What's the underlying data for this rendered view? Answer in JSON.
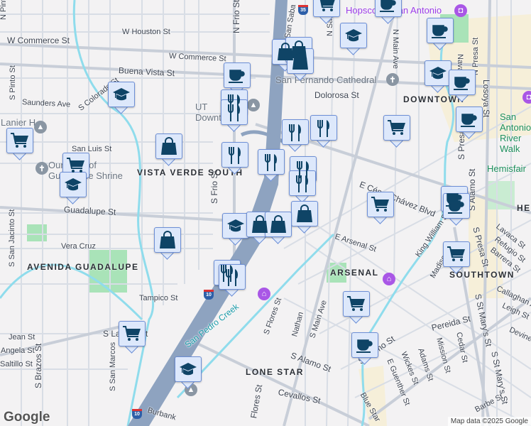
{
  "map": {
    "labels": [
      "W Houston St",
      "W Commerce St",
      "W Commerce St",
      "Buena Vista St",
      "Saunders Ave",
      "S Colorado St",
      "San Luis St",
      "Guadalupe St",
      "N Pinto St",
      "S Pinto St",
      "N Frio St",
      "S Frio St",
      "Vera Cruz",
      "Tampico St",
      "S San Jacinto St",
      "Jean St",
      "Angela St",
      "Saltillo St",
      "S Brazos St",
      "S Laredo St",
      "S San Marcos",
      "N Main Ave",
      "N Santa Rosa",
      "Dolorosa St",
      "E César Chávez Blvd",
      "E Arsenal St",
      "S Flores St",
      "S Main Ave",
      "Nathan",
      "S Alamo St",
      "S Alamo St",
      "Cevallos St",
      "Pereida St",
      "E Guenther St",
      "Wickes St",
      "Adams St",
      "Mission St",
      "Cedar St",
      "S St Mary's St",
      "S St Mary's St",
      "S Presa St",
      "S Presa St",
      "Navarro",
      "N Presa St",
      "Losoya St",
      "S Alamo St",
      "King William St",
      "Lavaca St",
      "Refugio St",
      "Barrera St",
      "Callaghan Ave",
      "Leigh St",
      "Devine St",
      "Barbe St",
      "Blue Star",
      "Flores St",
      "Burbank",
      "Madison",
      "San Saba"
    ],
    "neighborhoods": [
      "VISTA VERDE SOUTH",
      "AVENIDA GUADALUPE",
      "DOWNTOWN",
      "ARSENAL",
      "SOUTHTOWN",
      "LONE STAR",
      "HE"
    ],
    "pois": [
      "San Fernando Cathedral",
      "Our Lady of Guadalupe Shrine",
      "Lanier HS",
      "UT Downtown Campus",
      "Hemisfair",
      "San Antonio River Walk",
      "Hopscotch San Antonio",
      "San Pedro Creek"
    ],
    "highways": [
      "35",
      "10",
      "10"
    ],
    "attribution": "Map data ©2025 Google",
    "logo": "Google"
  },
  "colors": {
    "marker_bg": "#dde8fb",
    "marker_border": "#6d8fd6",
    "icon": "#0f4466",
    "highway": "#8ea3c0",
    "water": "#8fdcec",
    "park": "#a9e3b8"
  },
  "markers": [
    "cafe",
    "graduation-cap",
    "shopping-bag",
    "cart",
    "fork-knife"
  ]
}
